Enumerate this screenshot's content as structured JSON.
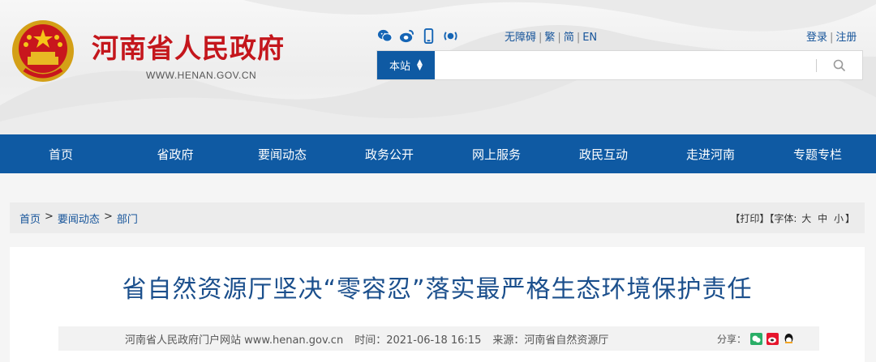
{
  "header": {
    "site_title": "河南省人民政府",
    "site_url": "WWW.HENAN.GOV.CN",
    "social": [
      "wechat-icon",
      "weibo-icon",
      "mobile-icon",
      "broadcast-icon"
    ],
    "lang_links": {
      "accessibility": "无障碍",
      "traditional": "繁",
      "simplified": "简",
      "english": "EN"
    },
    "auth_links": {
      "login": "登录",
      "register": "注册"
    },
    "search": {
      "scope": "本站",
      "value": ""
    }
  },
  "nav": {
    "items": [
      "首页",
      "省政府",
      "要闻动态",
      "政务公开",
      "网上服务",
      "政民互动",
      "走进河南",
      "专题专栏"
    ]
  },
  "breadcrumb": {
    "items": [
      "首页",
      "要闻动态",
      "部门"
    ],
    "separator": ">",
    "print": "【打印】",
    "font_size_label": "【字体:",
    "sizes": [
      "大",
      "中",
      "小"
    ],
    "close": "】"
  },
  "article": {
    "title": "省自然资源厅坚决“零容忍”落实最严格生态环境保护责任",
    "source_site": "河南省人民政府门户网站 www.henan.gov.cn",
    "time": "时间：2021-06-18 16:15",
    "origin": "来源：河南省自然资源厅",
    "share_label": "分享："
  },
  "colors": {
    "brand_red": "#c4161c",
    "nav_blue": "#0f5aa3",
    "title_blue": "#1b4f8c"
  }
}
